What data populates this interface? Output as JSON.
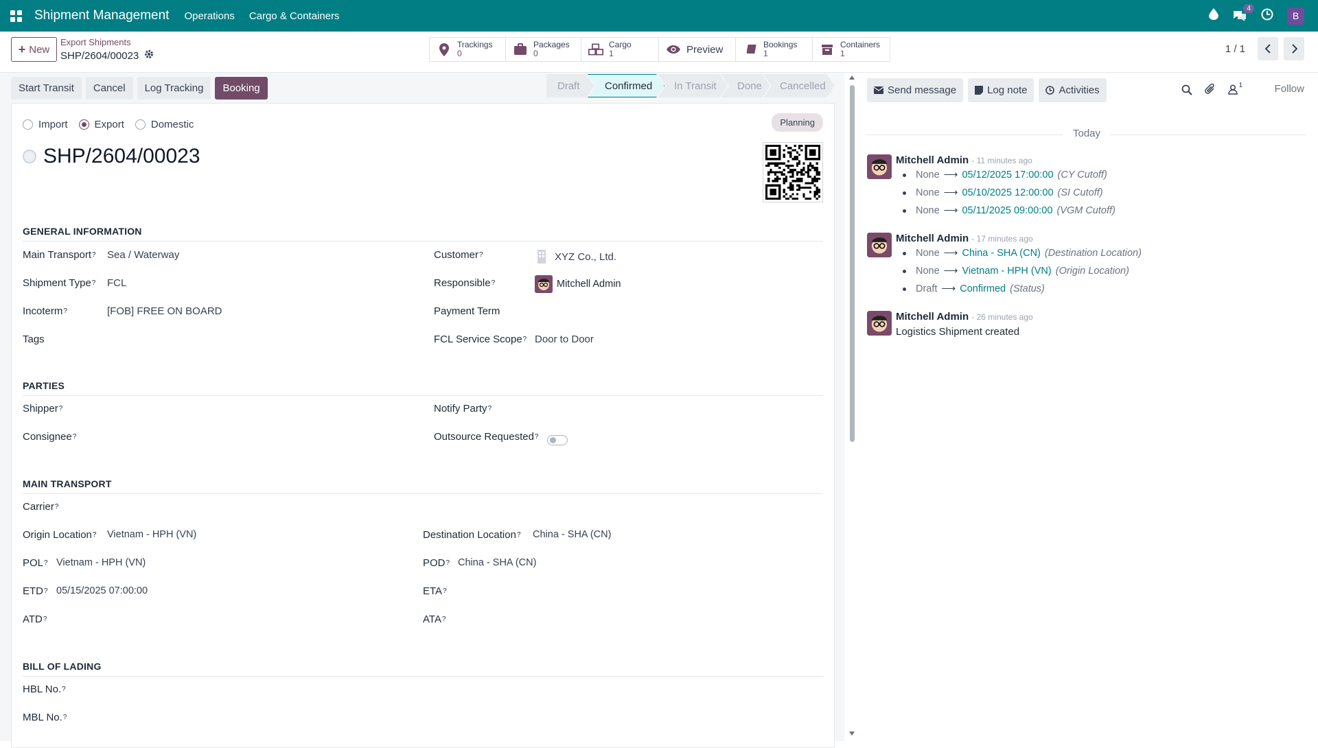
{
  "topbar": {
    "app_title": "Shipment Management",
    "menus": [
      "Operations",
      "Cargo & Containers"
    ],
    "notification_count": "4",
    "user_initial": "B"
  },
  "control_panel": {
    "new_label": "New",
    "breadcrumb_parent": "Export Shipments",
    "record_name": "SHP/2604/00023",
    "smart_buttons": [
      {
        "label": "Trackings",
        "value": "0",
        "icon": "map-pin-icon"
      },
      {
        "label": "Packages",
        "value": "0",
        "icon": "suitcase-icon"
      },
      {
        "label": "Cargo",
        "value": "1",
        "icon": "boxes-icon"
      },
      {
        "label": "Preview",
        "value": "",
        "icon": "eye-icon"
      },
      {
        "label": "Bookings",
        "value": "1",
        "icon": "book-icon"
      },
      {
        "label": "Containers",
        "value": "1",
        "icon": "archive-icon"
      }
    ],
    "pager": "1 / 1"
  },
  "header": {
    "buttons": [
      "Start Transit",
      "Cancel",
      "Log Tracking",
      "Booking"
    ],
    "stages": [
      "Draft",
      "Confirmed",
      "In Transit",
      "Done",
      "Cancelled"
    ],
    "active_stage": "Confirmed"
  },
  "form": {
    "direction_options": [
      "Import",
      "Export",
      "Domestic"
    ],
    "selected_direction": "Export",
    "ribbon": "Planning",
    "title": "SHP/2604/00023",
    "sections": {
      "general": "GENERAL INFORMATION",
      "parties": "PARTIES",
      "main_transport": "MAIN TRANSPORT",
      "bol": "BILL OF LADING"
    },
    "general": {
      "main_transport_label": "Main Transport",
      "main_transport": "Sea / Waterway",
      "shipment_type_label": "Shipment Type",
      "shipment_type": "FCL",
      "incoterm_label": "Incoterm",
      "incoterm": "[FOB] FREE ON BOARD",
      "tags_label": "Tags",
      "customer_label": "Customer",
      "customer": "XYZ Co., Ltd.",
      "responsible_label": "Responsible",
      "responsible": "Mitchell Admin",
      "payment_term_label": "Payment Term",
      "fcl_scope_label": "FCL Service Scope",
      "fcl_scope": "Door to Door"
    },
    "parties": {
      "shipper_label": "Shipper",
      "consignee_label": "Consignee",
      "notify_label": "Notify Party",
      "outsource_label": "Outsource Requested"
    },
    "transport": {
      "carrier_label": "Carrier",
      "origin_label": "Origin Location",
      "origin": "Vietnam - HPH (VN)",
      "dest_label": "Destination Location",
      "dest": "China - SHA (CN)",
      "pol_label": "POL",
      "pol": "Vietnam - HPH (VN)",
      "pod_label": "POD",
      "pod": "China - SHA (CN)",
      "etd_label": "ETD",
      "etd": "05/15/2025 07:00:00",
      "eta_label": "ETA",
      "atd_label": "ATD",
      "ata_label": "ATA"
    },
    "bol": {
      "hbl_label": "HBL No.",
      "mbl_label": "MBL No."
    }
  },
  "chatter": {
    "send_message": "Send message",
    "log_note": "Log note",
    "activities": "Activities",
    "follower_count": "1",
    "follow": "Follow",
    "today": "Today",
    "messages": [
      {
        "author": "Mitchell Admin",
        "time": "- 11 minutes ago",
        "changes": [
          {
            "old": "None",
            "new": "05/12/2025 17:00:00",
            "field": "(CY Cutoff)"
          },
          {
            "old": "None",
            "new": "05/10/2025 12:00:00",
            "field": "(SI Cutoff)"
          },
          {
            "old": "None",
            "new": "05/11/2025 09:00:00",
            "field": "(VGM Cutoff)"
          }
        ]
      },
      {
        "author": "Mitchell Admin",
        "time": "- 17 minutes ago",
        "changes": [
          {
            "old": "None",
            "new": "China - SHA (CN)",
            "field": "(Destination Location)"
          },
          {
            "old": "None",
            "new": "Vietnam - HPH (VN)",
            "field": "(Origin Location)"
          },
          {
            "old": "Draft",
            "new": "Confirmed",
            "field": "(Status)"
          }
        ]
      },
      {
        "author": "Mitchell Admin",
        "time": "- 26 minutes ago",
        "body": "Logistics Shipment created"
      }
    ]
  }
}
